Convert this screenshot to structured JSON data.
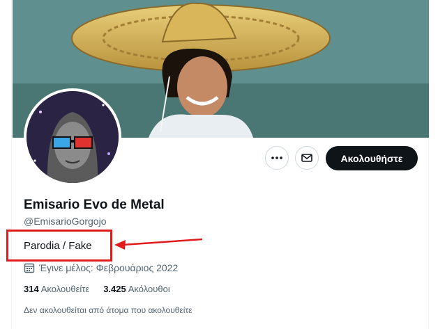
{
  "profile": {
    "display_name": "Emisario Evo de Metal",
    "handle": "@EmisarioGorgojo",
    "bio": "Parodia / Fake",
    "joined": "Έγινε μέλος: Φεβρουάριος 2022",
    "following_count": "314",
    "following_label": "Ακολουθείτε",
    "followers_count": "3.425",
    "followers_label": "Ακόλουθοι",
    "followed_by_text": "Δεν ακολουθείται από άτομα που ακολουθείτε"
  },
  "actions": {
    "follow_label": "Ακολουθήστε",
    "more_icon": "more-icon",
    "message_icon": "envelope-icon"
  },
  "annotation": {
    "box_color": "#e01b1b"
  }
}
